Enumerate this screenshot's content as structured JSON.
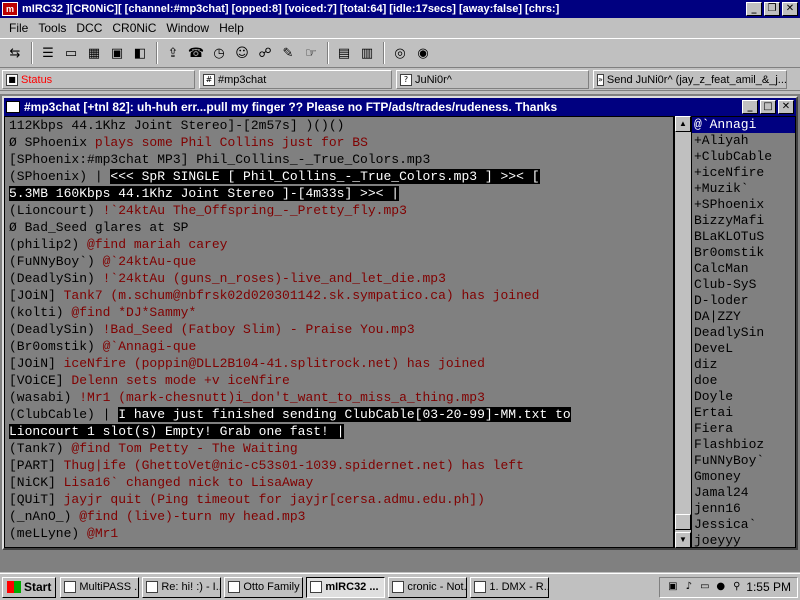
{
  "window": {
    "title": "mIRC32 ][CR0NiC][ [channel:#mp3chat] [opped:8] [voiced:7] [total:64] [idle:17secs] [away:false] [chrs:]"
  },
  "menu": [
    "File",
    "Tools",
    "DCC",
    "CR0NiC",
    "Window",
    "Help"
  ],
  "switchbar": {
    "tabs": [
      {
        "label": "Status",
        "color": "#ff0000"
      },
      {
        "label": "#mp3chat",
        "color": "#000000"
      },
      {
        "label": "JuNi0r^",
        "color": "#000000"
      },
      {
        "label": "Send JuNi0r^ (jay_z_feat_amil_&_j...",
        "color": "#000000"
      }
    ]
  },
  "channel": {
    "title": "#mp3chat [+tnl 82]: uh-huh err...pull my finger ?? Please no FTP/ads/trades/rudeness.  Thanks",
    "lines": [
      {
        "parts": [
          {
            "t": "  112Kbps 44.1Khz Joint Stereo]-[2m57s] )()()",
            "c": "c-gray"
          }
        ]
      },
      {
        "parts": [
          {
            "t": "Ø SPhoenix ",
            "c": "c-gray"
          },
          {
            "t": "plays some Phil Collins just for BS",
            "c": "c-maroon"
          }
        ]
      },
      {
        "parts": [
          {
            "t": "[SPhoenix:#mp3chat MP3] Phil_Collins_-_True_Colors.mp3",
            "c": "c-gray"
          }
        ]
      },
      {
        "parts": [
          {
            "t": "(SPhoenix) | ",
            "c": "c-gray"
          },
          {
            "t": "<<< SpR SINGLE [ Phil_Collins_-_True_Colors.mp3 ] >>< [",
            "c": "hl"
          }
        ]
      },
      {
        "parts": [
          {
            "t": "5.3MB 160Kbps 44.1Khz Joint Stereo ]-[4m33s] >>< |",
            "c": "hl"
          }
        ]
      },
      {
        "parts": [
          {
            "t": "(Lioncourt) ",
            "c": "c-gray"
          },
          {
            "t": "!`24ktAu The_Offspring_-_Pretty_fly.mp3",
            "c": "c-maroon"
          }
        ]
      },
      {
        "parts": [
          {
            "t": "Ø Bad_Seed glares at SP",
            "c": "c-gray"
          }
        ]
      },
      {
        "parts": [
          {
            "t": "(philip2) ",
            "c": "c-gray"
          },
          {
            "t": "@find mariah carey",
            "c": "c-maroon"
          }
        ]
      },
      {
        "parts": [
          {
            "t": "(FuNNyBoy`) ",
            "c": "c-gray"
          },
          {
            "t": "@`24ktAu-que",
            "c": "c-maroon"
          }
        ]
      },
      {
        "parts": [
          {
            "t": "(DeadlySin) ",
            "c": "c-gray"
          },
          {
            "t": "!`24ktAu (guns_n_roses)-live_and_let_die.mp3",
            "c": "c-maroon"
          }
        ]
      },
      {
        "parts": [
          {
            "t": "[JOiN] ",
            "c": "c-gray"
          },
          {
            "t": "Tank7 (m.schum@nbfrsk02d020301142.sk.sympatico.ca) has joined",
            "c": "c-maroon"
          }
        ]
      },
      {
        "parts": [
          {
            "t": "(kolti) ",
            "c": "c-gray"
          },
          {
            "t": "@find *DJ*Sammy*",
            "c": "c-maroon"
          }
        ]
      },
      {
        "parts": [
          {
            "t": "(DeadlySin) ",
            "c": "c-gray"
          },
          {
            "t": "!Bad_Seed (Fatboy Slim) - Praise You.mp3",
            "c": "c-maroon"
          }
        ]
      },
      {
        "parts": [
          {
            "t": "(Br0omstik) ",
            "c": "c-gray"
          },
          {
            "t": "@`Annagi-que",
            "c": "c-maroon"
          }
        ]
      },
      {
        "parts": [
          {
            "t": "[JOiN] ",
            "c": "c-gray"
          },
          {
            "t": "iceNfire (poppin@DLL2B104-41.splitrock.net) has joined",
            "c": "c-maroon"
          }
        ]
      },
      {
        "parts": [
          {
            "t": "[VOiCE] ",
            "c": "c-gray"
          },
          {
            "t": "Delenn sets mode +v iceNfire",
            "c": "c-maroon"
          }
        ]
      },
      {
        "parts": [
          {
            "t": "(wasabi) ",
            "c": "c-gray"
          },
          {
            "t": "!Mr1 (mark-chesnutt)i_don't_want_to_miss_a_thing.mp3",
            "c": "c-maroon"
          }
        ]
      },
      {
        "parts": [
          {
            "t": "(ClubCable) | ",
            "c": "c-gray"
          },
          {
            "t": " I have just finished sending ClubCable[03-20-99]-MM.txt to",
            "c": "hl"
          }
        ]
      },
      {
        "parts": [
          {
            "t": "Lioncourt  1 slot(s) Empty! Grab one fast! |",
            "c": "hl"
          }
        ]
      },
      {
        "parts": [
          {
            "t": "(Tank7) ",
            "c": "c-gray"
          },
          {
            "t": "@find Tom Petty - The Waiting",
            "c": "c-maroon"
          }
        ]
      },
      {
        "parts": [
          {
            "t": "[PART] ",
            "c": "c-gray"
          },
          {
            "t": "Thug|ife (GhettoVet@nic-c53s01-1039.spidernet.net) has left",
            "c": "c-maroon"
          }
        ]
      },
      {
        "parts": [
          {
            "t": "[NiCK] ",
            "c": "c-gray"
          },
          {
            "t": "Lisa16` changed nick to LisaAway",
            "c": "c-maroon"
          }
        ]
      },
      {
        "parts": [
          {
            "t": "[QUiT] ",
            "c": "c-gray"
          },
          {
            "t": "jayjr quit (Ping timeout for jayjr[cersa.admu.edu.ph])",
            "c": "c-maroon"
          }
        ]
      },
      {
        "parts": [
          {
            "t": "(_nAnO_) ",
            "c": "c-gray"
          },
          {
            "t": "@find (live)-turn my head.mp3",
            "c": "c-maroon"
          }
        ]
      },
      {
        "parts": [
          {
            "t": "(meLLyne) ",
            "c": "c-gray"
          },
          {
            "t": "@Mr1",
            "c": "c-maroon"
          }
        ]
      }
    ],
    "nicks": [
      "@`Annagi",
      "+Aliyah",
      "+ClubCable",
      "+iceNfire",
      "+Muzik`",
      "+SPhoenix",
      "BizzyMafi",
      "BLaKLOTuS",
      "Br0omstik",
      "CalcMan",
      "Club-SyS",
      "D-loder",
      "DA|ZZY",
      "DeadlySin",
      "DeveL",
      "diz",
      "doe",
      "Doyle",
      "Ertai",
      "Fiera",
      "Flashbioz",
      "FuNNyBoy`",
      "Gmoney",
      "Jamal24",
      "jenn16",
      "Jessica`",
      "joeyyy"
    ]
  },
  "taskbar": {
    "start": "Start",
    "tasks": [
      "MultiPASS ...",
      "Re: hi! :) - I...",
      "Otto Family ...",
      "mIRC32 ...",
      "cronic - Not...",
      "1. DMX - R..."
    ],
    "active_task": 3,
    "clock": "1:55 PM"
  }
}
